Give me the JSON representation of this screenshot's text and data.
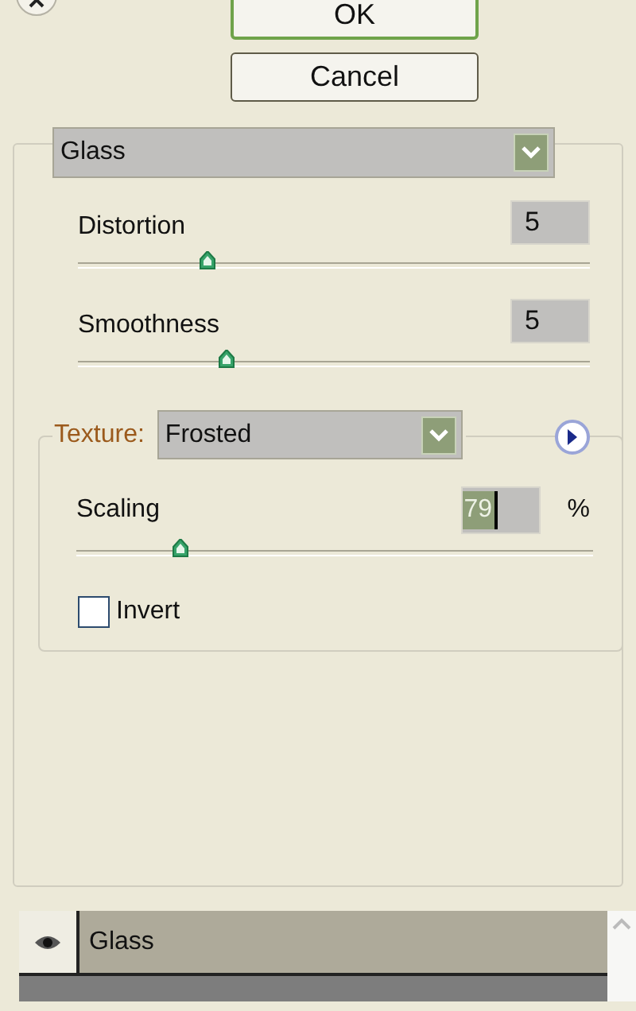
{
  "buttons": [
    {
      "label": "OK",
      "kind": "default"
    },
    {
      "label": "Cancel",
      "kind": "normal"
    }
  ],
  "effect": {
    "value": "Glass"
  },
  "sliders": [
    {
      "label": "Distortion",
      "value": "5",
      "level": 0.25
    },
    {
      "label": "Smoothness",
      "value": "5",
      "level": 0.29
    }
  ],
  "texture": {
    "label": "Texture:",
    "value": "Frosted",
    "scaling": {
      "label": "Scaling",
      "value": "79",
      "unit": "%",
      "level": 0.2
    },
    "invert": {
      "label": "Invert",
      "checked": false
    }
  },
  "layers": [
    {
      "name": "Glass",
      "visible": true
    }
  ]
}
